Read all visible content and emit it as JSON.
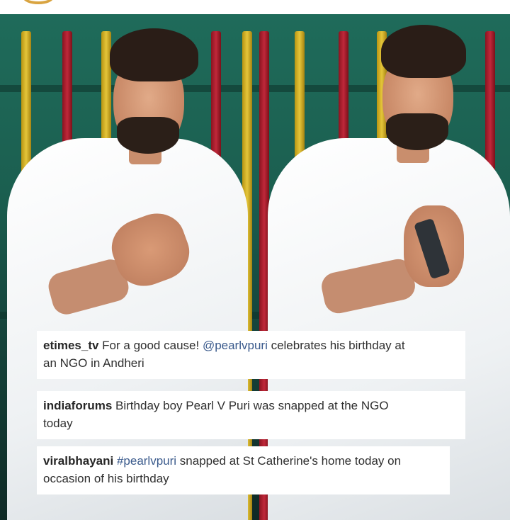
{
  "post": {
    "photo_left": {
      "subject": "man-in-white-kurta-hand-on-chest"
    },
    "photo_right": {
      "subject": "man-in-white-kurta-folded-hands"
    }
  },
  "captions": [
    {
      "username": "etimes_tv",
      "line1_before": "For a good cause! ",
      "mention": "@pearlvpuri",
      "line1_after": " celebrates his birthday at",
      "line2": "an NGO in Andheri"
    },
    {
      "username": "indiaforums",
      "line1": "Birthday boy Pearl V Puri was snapped at the NGO",
      "line2": "today"
    },
    {
      "username": "viralbhayani",
      "hashtag": "#pearlvpuri",
      "line1_after": " snapped at St Catherine's home today on",
      "line2": "occasion of his birthday"
    }
  ],
  "colors": {
    "background_green": "#1f6b5a",
    "pole_yellow": "#e4c53a",
    "pole_red": "#c0283a",
    "caption_text": "#2f2f2f",
    "link_blue": "#3a5a8c"
  }
}
